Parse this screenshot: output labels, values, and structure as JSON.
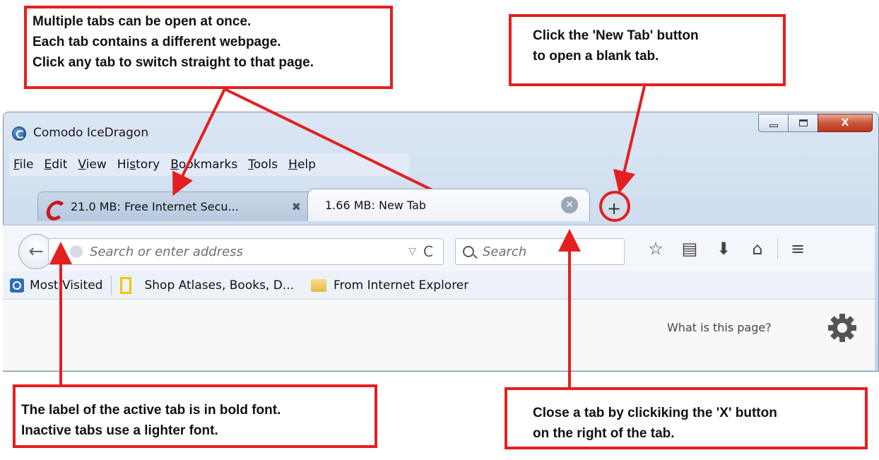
{
  "window": {
    "title": "Comodo IceDragon",
    "controls": {
      "minimize": "minimize",
      "maximize": "maximize",
      "close": "X"
    }
  },
  "menubar": {
    "items": [
      {
        "accel": "F",
        "rest": "ile"
      },
      {
        "accel": "E",
        "rest": "dit"
      },
      {
        "accel": "V",
        "rest": "iew"
      },
      {
        "accel": "",
        "pre": "Hi",
        "accel2": "s",
        "rest": "tory"
      },
      {
        "accel": "B",
        "rest": "ookmarks"
      },
      {
        "accel": "T",
        "rest": "ools"
      },
      {
        "accel": "H",
        "rest": "elp"
      }
    ]
  },
  "tabs": {
    "inactive_label": "21.0 MB: Free Internet Secu...",
    "inactive_close": "✖",
    "active_label": "1.66 MB: New Tab",
    "active_close": "✕",
    "new_tab": "+"
  },
  "navbar": {
    "back": "←",
    "address_placeholder": "Search or enter address",
    "dropmarker": "▽",
    "reload": "C",
    "search_placeholder": "Search",
    "icons": [
      "star-icon",
      "reading-list-icon",
      "download-icon",
      "home-icon",
      "menu-icon"
    ],
    "icon_glyphs": [
      "☆",
      "▤",
      "⬇",
      "⌂",
      "≡"
    ]
  },
  "bookmarks": {
    "most_visited": "Most Visited",
    "shop": "Shop Atlases, Books, D...",
    "from_ie": "From Internet Explorer"
  },
  "content": {
    "what_is_this": "What is this page?"
  },
  "callouts": {
    "multi_tabs": [
      "Multiple tabs can be open at once.",
      "Each tab contains a different webpage.",
      "Click any tab to switch straight to that page."
    ],
    "new_tab": [
      "Click the 'New Tab' button",
      "to open a blank tab."
    ],
    "active_bold": [
      "The label of the active tab is in bold font.",
      "Inactive tabs use a lighter font."
    ],
    "close_tab": [
      "Close a tab by clickiking the 'X' button",
      "on the right of the tab."
    ]
  },
  "colors": {
    "annotation_red": "#e41f1f",
    "window_frame": "#c9daee",
    "close_button": "#c75135",
    "comodo_red": "#c8181f"
  }
}
